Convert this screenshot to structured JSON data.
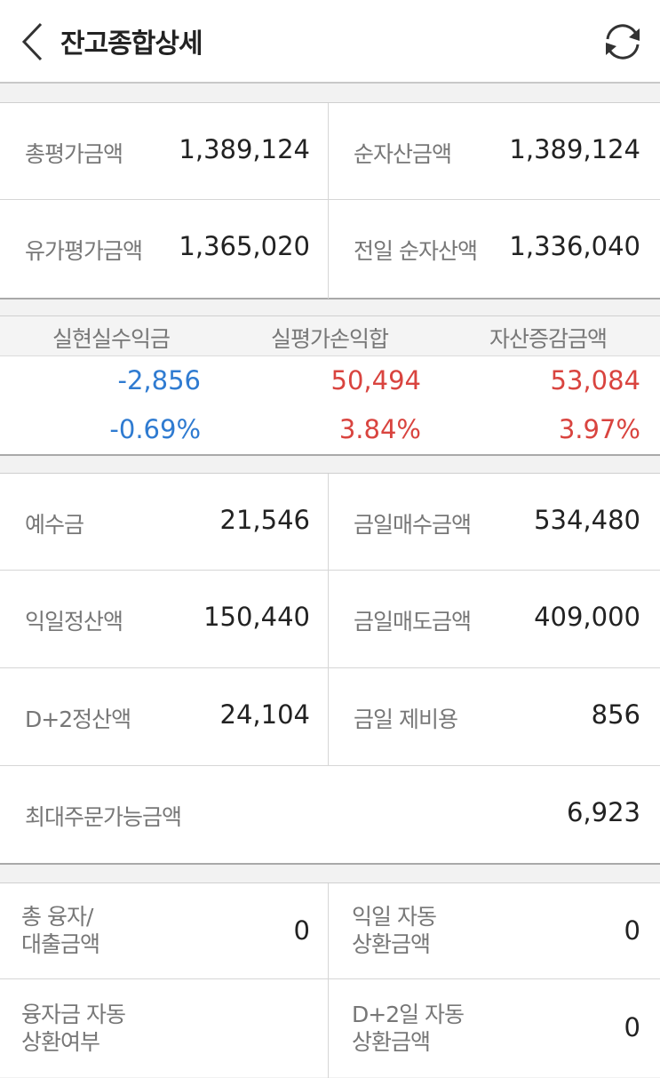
{
  "header": {
    "title": "잔고종합상세"
  },
  "summary": {
    "total_eval_label": "총평가금액",
    "total_eval_value": "1,389,124",
    "net_asset_label": "순자산금액",
    "net_asset_value": "1,389,124",
    "securities_eval_label": "유가평가금액",
    "securities_eval_value": "1,365,020",
    "prev_net_asset_label": "전일 순자산액",
    "prev_net_asset_value": "1,336,040"
  },
  "pnl": {
    "headers": [
      "실현실수익금",
      "실평가손익합",
      "자산증감금액"
    ],
    "amounts": [
      "-2,856",
      "50,494",
      "53,084"
    ],
    "rates": [
      "-0.69%",
      "3.84%",
      "3.97%"
    ]
  },
  "cash": {
    "deposit_label": "예수금",
    "deposit_value": "21,546",
    "today_buy_label": "금일매수금액",
    "today_buy_value": "534,480",
    "next_day_settle_label": "익일정산액",
    "next_day_settle_value": "150,440",
    "today_sell_label": "금일매도금액",
    "today_sell_value": "409,000",
    "d2_settle_label": "D+2정산액",
    "d2_settle_value": "24,104",
    "today_fee_label": "금일 제비용",
    "today_fee_value": "856",
    "max_order_label": "최대주문가능금액",
    "max_order_value": "6,923"
  },
  "loan": {
    "total_loan_label_1": "총 융자/",
    "total_loan_label_2": "대출금액",
    "total_loan_value": "0",
    "next_auto_repay_label_1": "익일 자동",
    "next_auto_repay_label_2": "상환금액",
    "next_auto_repay_value": "0",
    "loan_auto_repay_label_1": "융자금 자동",
    "loan_auto_repay_label_2": "상환여부",
    "d2_auto_repay_label_1": "D+2일 자동",
    "d2_auto_repay_label_2": "상환금액",
    "d2_auto_repay_value": "0"
  },
  "colors": {
    "negative": "#2f7bd1",
    "positive": "#d9443f"
  },
  "icons": {
    "back": "chevron-left-icon",
    "refresh": "refresh-icon"
  }
}
